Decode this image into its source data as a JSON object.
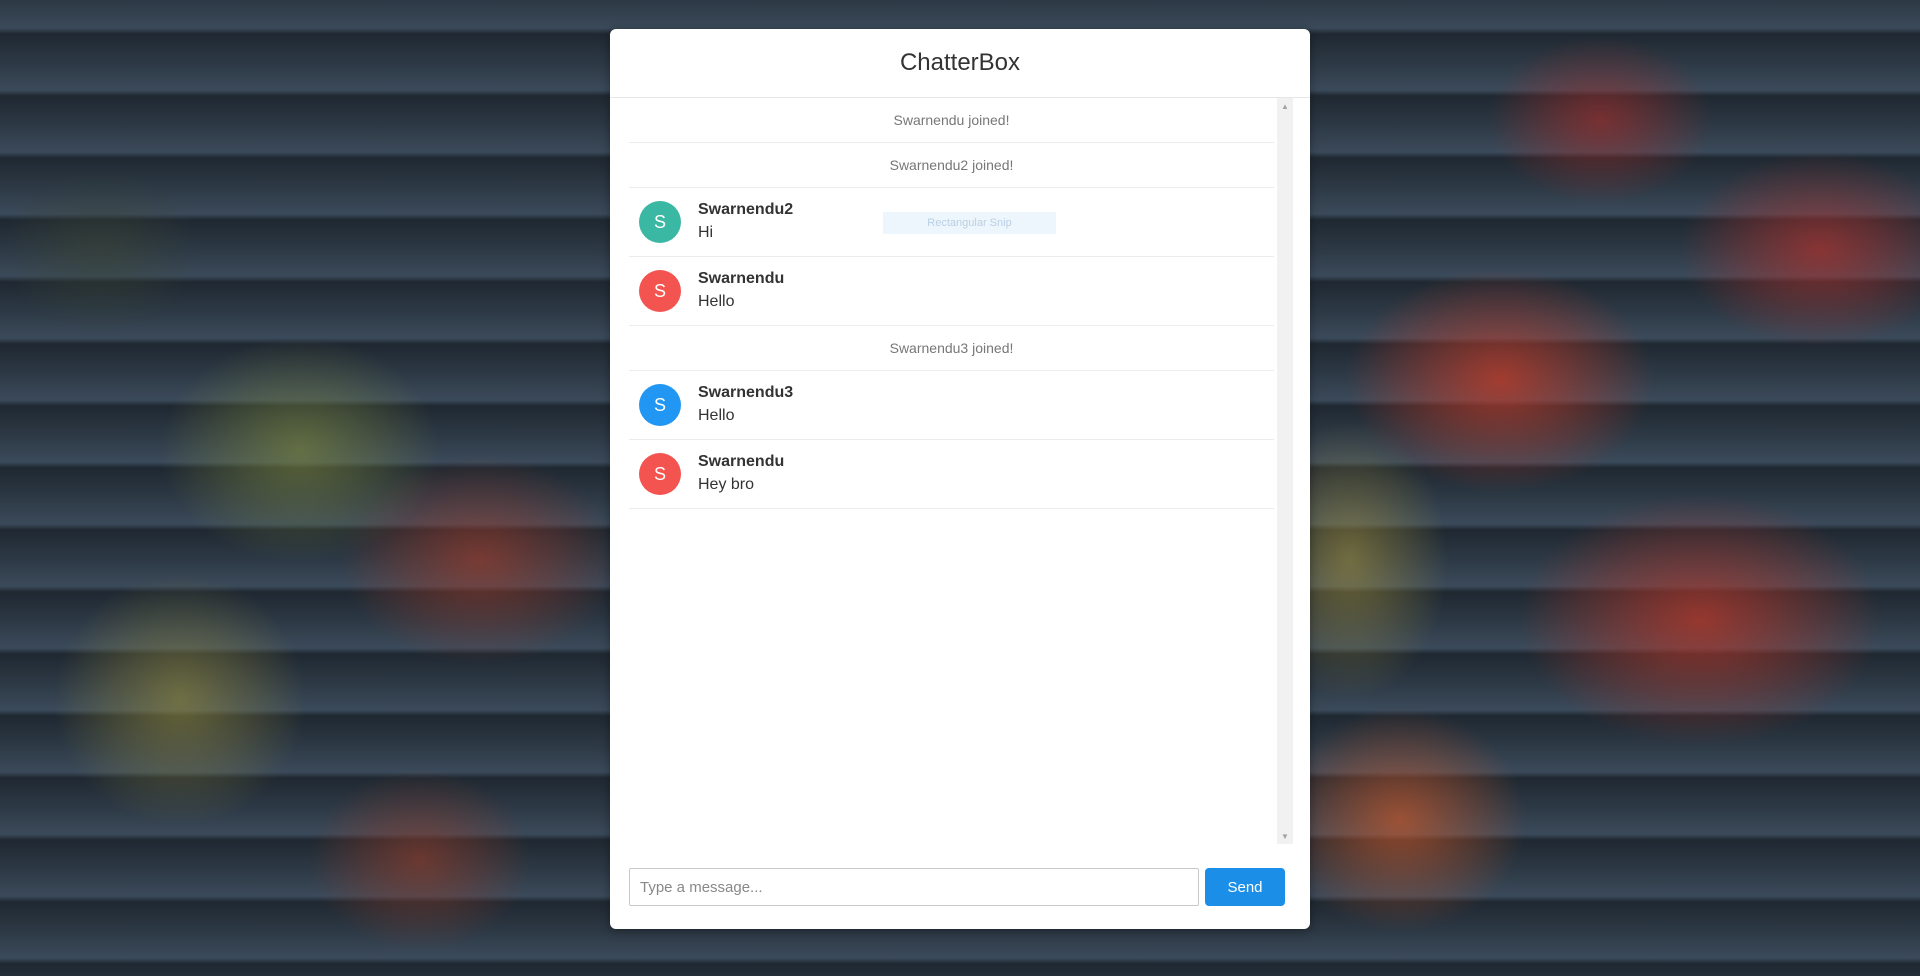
{
  "app": {
    "title": "ChatterBox"
  },
  "messages": [
    {
      "type": "system",
      "text": "Swarnendu joined!"
    },
    {
      "type": "system",
      "text": "Swarnendu2 joined!"
    },
    {
      "type": "chat",
      "initial": "S",
      "user": "Swarnendu2",
      "text": "Hi",
      "avatar_color": "#3bb8a4"
    },
    {
      "type": "chat",
      "initial": "S",
      "user": "Swarnendu",
      "text": "Hello",
      "avatar_color": "#f4544f"
    },
    {
      "type": "system",
      "text": "Swarnendu3 joined!"
    },
    {
      "type": "chat",
      "initial": "S",
      "user": "Swarnendu3",
      "text": "Hello",
      "avatar_color": "#2196f3"
    },
    {
      "type": "chat",
      "initial": "S",
      "user": "Swarnendu",
      "text": "Hey bro",
      "avatar_color": "#f4544f"
    }
  ],
  "overlay": {
    "snip_label": "Rectangular Snip"
  },
  "composer": {
    "placeholder": "Type a message...",
    "value": "",
    "send_label": "Send"
  },
  "colors": {
    "accent": "#1b8fe8"
  }
}
